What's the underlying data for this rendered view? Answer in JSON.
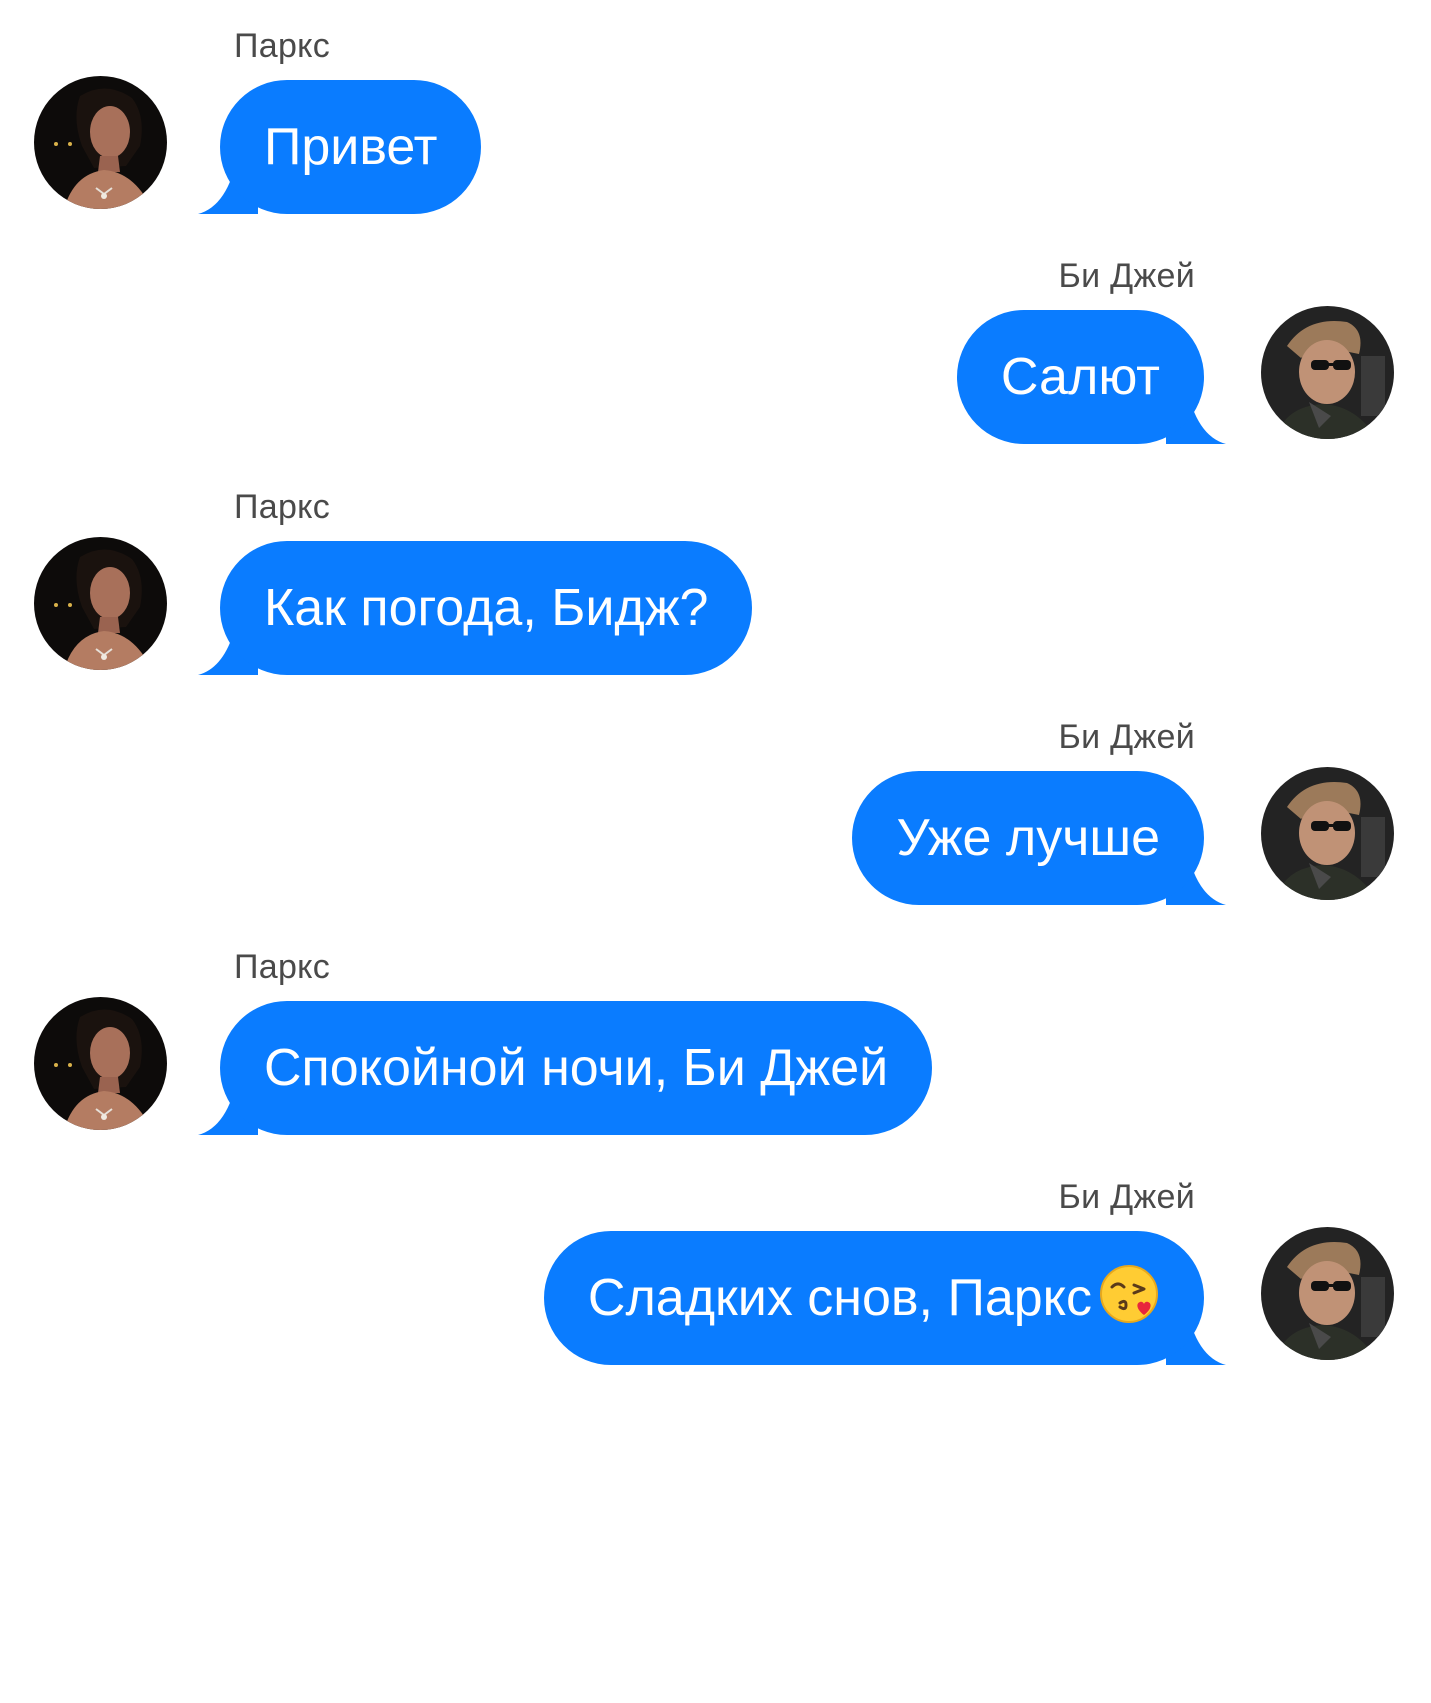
{
  "colors": {
    "bubble": "#0a7cff",
    "bubble_text": "#ffffff",
    "sender_text": "#4a4a4a",
    "background": "#ffffff"
  },
  "participants": {
    "parks": {
      "name": "Паркс",
      "avatar_icon": "woman-portrait-avatar-icon"
    },
    "bj": {
      "name": "Би Джей",
      "avatar_icon": "man-sunglasses-avatar-icon"
    }
  },
  "messages": [
    {
      "sender": "Паркс",
      "text": "Привет",
      "direction": "incoming"
    },
    {
      "sender": "Би Джей",
      "text": "Салют",
      "direction": "outgoing"
    },
    {
      "sender": "Паркс",
      "text": "Как погода, Бидж?",
      "direction": "incoming"
    },
    {
      "sender": "Би Джей",
      "text": "Уже лучше",
      "direction": "outgoing"
    },
    {
      "sender": "Паркс",
      "text": "Спокойной ночи, Би Джей",
      "direction": "incoming"
    },
    {
      "sender": "Би Джей",
      "text": "Сладких снов, Паркс",
      "direction": "outgoing",
      "emoji": "face-blowing-kiss-emoji-icon"
    }
  ]
}
